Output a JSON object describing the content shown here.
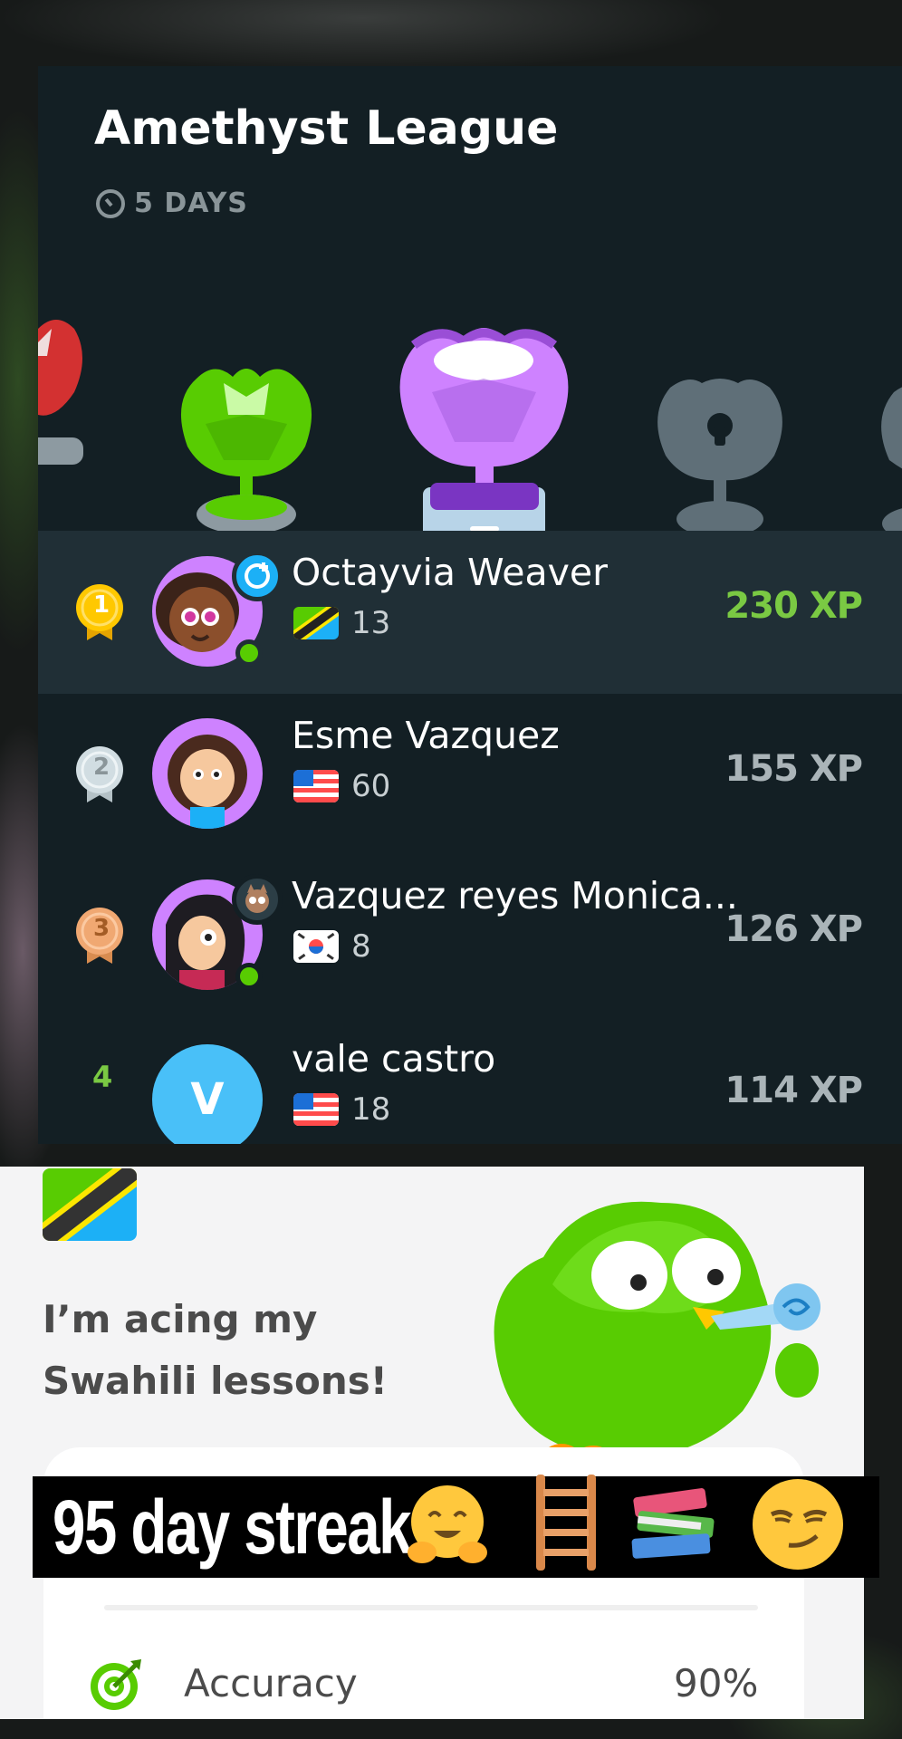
{
  "league": {
    "title": "Amethyst League",
    "time_left": "5 DAYS",
    "trophies": [
      "ruby-trophy",
      "emerald-trophy",
      "amethyst-trophy",
      "locked-trophy",
      "locked-trophy"
    ]
  },
  "leaderboard": [
    {
      "rank": "1",
      "name": "Octayvia Weaver",
      "flag": "tanzania-flag",
      "streak": "13",
      "xp": "230 XP",
      "online": true,
      "highlighted": true
    },
    {
      "rank": "2",
      "name": "Esme Vazquez",
      "flag": "us-flag",
      "streak": "60",
      "xp": "155 XP",
      "online": false,
      "highlighted": false
    },
    {
      "rank": "3",
      "name": "Vazquez reyes Monica...",
      "flag": "korea-flag",
      "streak": "8",
      "xp": "126 XP",
      "online": true,
      "highlighted": false
    },
    {
      "rank": "4",
      "name": "vale castro",
      "avatar_letter": "V",
      "flag": "us-flag",
      "streak": "18",
      "xp": "114 XP",
      "online": false,
      "highlighted": false
    }
  ],
  "share_card": {
    "flag": "tanzania-flag",
    "message": "I’m acing my Swahili lessons!",
    "stat_label": "Accuracy",
    "stat_value": "90%"
  },
  "caption": {
    "text": "95 day streak",
    "emojis": [
      "hugging-face-emoji",
      "ladder-emoji",
      "books-emoji",
      "smirk-emoji"
    ]
  },
  "colors": {
    "panel_bg": "#131f24",
    "highlight_bg": "#202f36",
    "xp_green": "#7ac943",
    "online_green": "#58cc02",
    "amethyst": "#ce82ff"
  }
}
